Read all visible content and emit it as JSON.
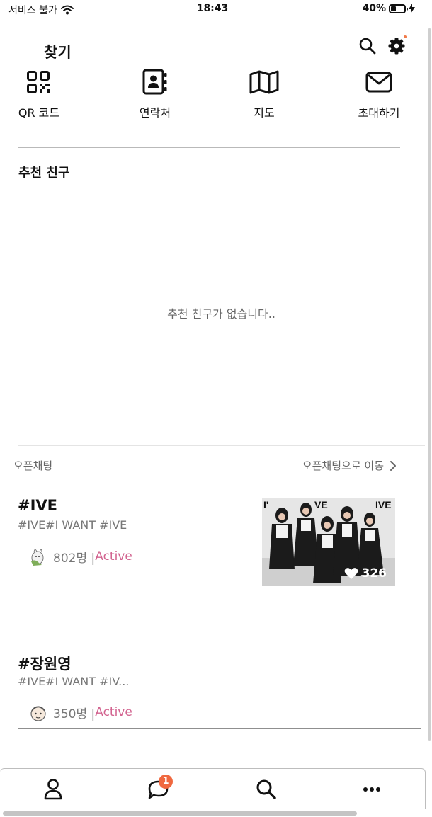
{
  "status_bar": {
    "carrier": "서비스 불가",
    "time": "18:43",
    "battery_percent": "40%",
    "battery_level": 0.4
  },
  "header": {
    "title": "찾기"
  },
  "quick_actions": [
    {
      "label": "QR 코드",
      "icon": "qr-code-icon"
    },
    {
      "label": "연락처",
      "icon": "contacts-icon"
    },
    {
      "label": "지도",
      "icon": "map-icon"
    },
    {
      "label": "초대하기",
      "icon": "envelope-icon"
    }
  ],
  "recommended": {
    "title": "추천 친구",
    "empty_message": "추천 친구가 없습니다.."
  },
  "open_chat": {
    "title": "오픈채팅",
    "link": "오픈채팅으로 이동",
    "rooms": [
      {
        "name": "#IVE",
        "tags": "#IVE#I WANT #IVE",
        "members": "802명 |",
        "status": "Active",
        "likes": "326",
        "thumb_text": [
          "I'",
          "VE",
          "IVE"
        ]
      },
      {
        "name": "#장원영",
        "tags": "#IVE#I WANT #IV...",
        "members": "350명 |",
        "status": "Active"
      }
    ]
  },
  "tab_bar": {
    "items": [
      "profile-icon",
      "chat-icon",
      "search-icon",
      "more-icon"
    ],
    "chat_badge": "1"
  },
  "colors": {
    "accent_active": "#d2638f",
    "badge": "#f0683f"
  }
}
